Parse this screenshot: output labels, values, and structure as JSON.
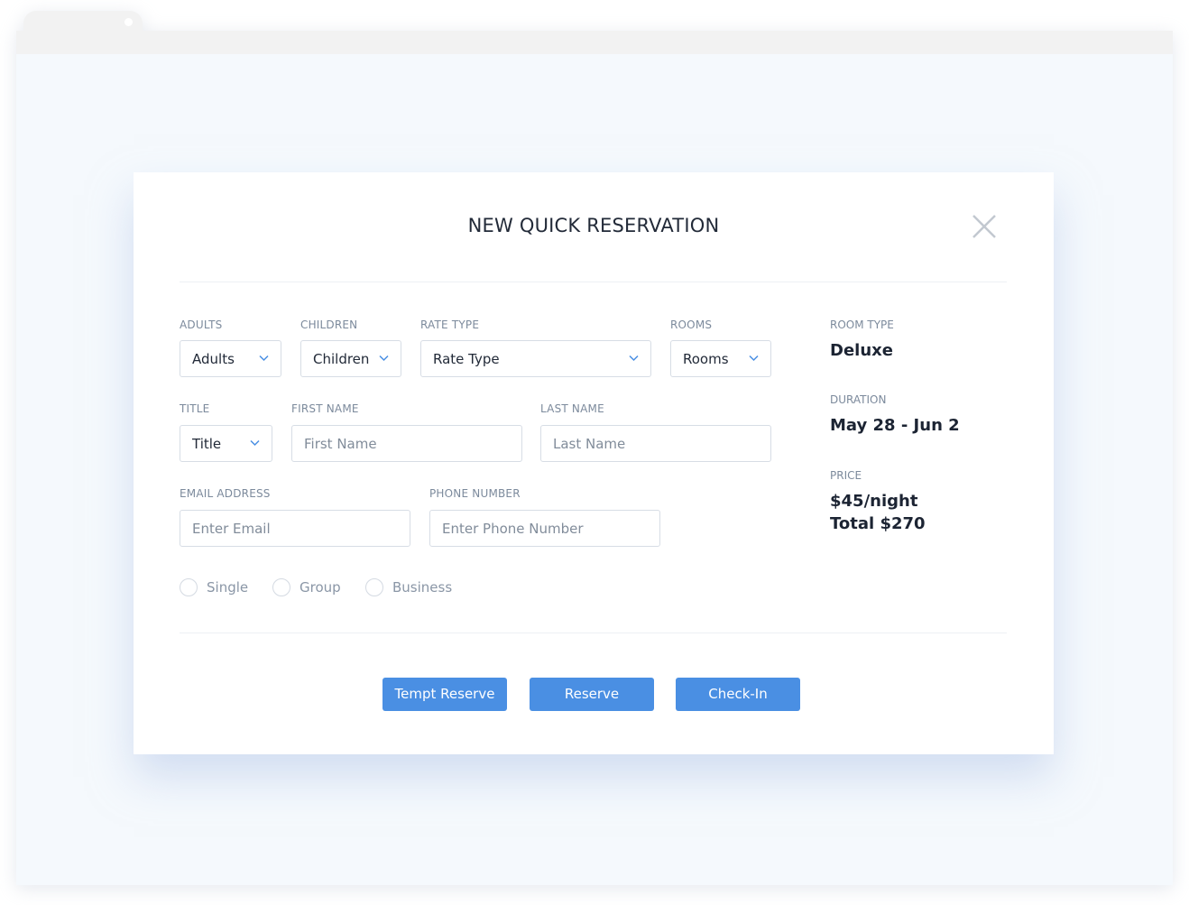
{
  "modal": {
    "title": "NEW QUICK RESERVATION"
  },
  "booking": {
    "adults": {
      "label": "ADULTS",
      "value": "Adults"
    },
    "children": {
      "label": "CHILDREN",
      "value": "Children"
    },
    "rate_type": {
      "label": "RATE TYPE",
      "value": "Rate Type"
    },
    "rooms": {
      "label": "ROOMS",
      "value": "Rooms"
    }
  },
  "guest": {
    "title": {
      "label": "TITLE",
      "value": "Title"
    },
    "first_name": {
      "label": "FIRST NAME",
      "placeholder": "First Name"
    },
    "last_name": {
      "label": "LAST NAME",
      "placeholder": "Last Name"
    },
    "email": {
      "label": "EMAIL ADDRESS",
      "placeholder": "Enter Email"
    },
    "phone": {
      "label": "PHONE NUMBER",
      "placeholder": "Enter Phone Number"
    }
  },
  "reservation_kind": {
    "options": [
      "Single",
      "Group",
      "Business"
    ]
  },
  "summary": {
    "room_type_label": "ROOM TYPE",
    "room_type_value": "Deluxe",
    "duration_label": "DURATION",
    "duration_value": "May 28 - Jun 2",
    "price_label": "PRICE",
    "price_per_night": "$45/night",
    "price_total": "Total $270"
  },
  "actions": {
    "tempt_reserve": "Tempt Reserve",
    "reserve": "Reserve",
    "check_in": "Check-In"
  },
  "colors": {
    "accent": "#4a8fe3",
    "background": "#f5f9fd",
    "text": "#222a38",
    "label": "#7c8a9c"
  },
  "icons": {
    "close": "close-icon",
    "dropdown": "chevron-down-icon"
  }
}
